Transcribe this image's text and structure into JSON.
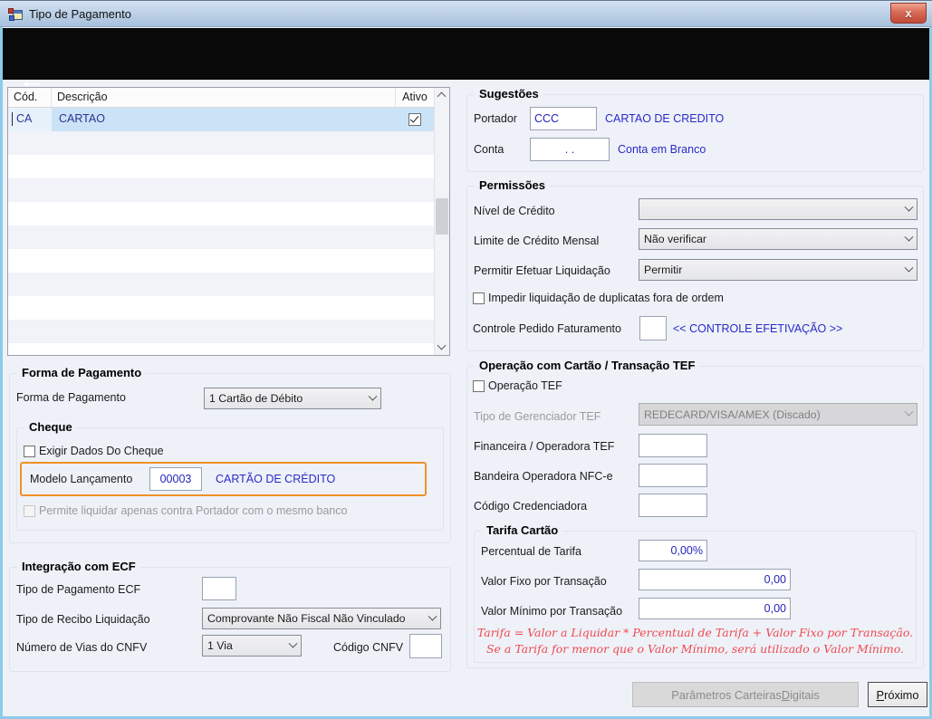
{
  "window": {
    "title": "Tipo de Pagamento"
  },
  "icons": {
    "close": "x",
    "back_arrow": "←",
    "app_icon": "winforms-window-icon",
    "chevron_down": "v-chevron",
    "check": "checkmark"
  },
  "grid": {
    "columns": {
      "cod": "Cód.",
      "descricao": "Descrição",
      "ativo": "Ativo"
    },
    "rows": [
      {
        "cod": "CA",
        "descricao": "CARTAO",
        "ativo_checked": true
      }
    ]
  },
  "forma_pagamento": {
    "title": "Forma de Pagamento",
    "label": "Forma de Pagamento",
    "value": "1 Cartão de Débito",
    "cheque": {
      "title": "Cheque",
      "exigir_checkbox": "Exigir Dados Do Cheque",
      "modelo_label": "Modelo Lançamento",
      "modelo_value": "00003",
      "modelo_desc": "CARTÃO DE CRÉDITO",
      "permite_checkbox": "Permite liquidar apenas contra Portador com o mesmo banco"
    }
  },
  "integracao_ecf": {
    "title": "Integração com ECF",
    "tipo_pagamento_label": "Tipo de Pagamento ECF",
    "tipo_pagamento_value": "",
    "tipo_recibo_label": "Tipo de Recibo Liquidação",
    "tipo_recibo_value": "Comprovante Não Fiscal Não Vinculado",
    "numero_vias_label": "Número de Vias do CNFV",
    "numero_vias_value": "1 Via",
    "codigo_cnfv_label": "Código CNFV",
    "codigo_cnfv_value": ""
  },
  "sugestoes": {
    "title": "Sugestões",
    "portador_label": "Portador",
    "portador_value": "CCC",
    "portador_desc": "CARTAO DE CREDITO",
    "conta_label": "Conta",
    "conta_value": ". .",
    "conta_desc": "Conta em Branco"
  },
  "permissoes": {
    "title": "Permissões",
    "nivel_label": "Nível de Crédito",
    "nivel_value": "",
    "limite_label": "Limite de Crédito Mensal",
    "limite_value": "Não verificar",
    "permitir_label": "Permitir Efetuar Liquidação",
    "permitir_value": "Permitir",
    "impedir_checkbox": "Impedir liquidação de duplicatas fora de ordem",
    "controle_label": "Controle Pedido Faturamento",
    "controle_value": "",
    "controle_link": "<< CONTROLE EFETIVAÇÃO >>"
  },
  "operacao_tef": {
    "title": "Operação com Cartão / Transação TEF",
    "operacao_checkbox": "Operação TEF",
    "gerenciador_label": "Tipo de Gerenciador TEF",
    "gerenciador_value": "REDECARD/VISA/AMEX (Discado)",
    "financeira_label": "Financeira / Operadora TEF",
    "financeira_value": "",
    "bandeira_label": "Bandeira Operadora NFC-e",
    "bandeira_value": "",
    "credenciadora_label": "Código Credenciadora",
    "credenciadora_value": "",
    "tarifa": {
      "title": "Tarifa Cartão",
      "percentual_label": "Percentual de Tarifa",
      "percentual_value": "0,00%",
      "fixo_label": "Valor Fixo por Transação",
      "fixo_value": "0,00",
      "minimo_label": "Valor Mínimo por Transação",
      "minimo_value": "0,00",
      "note_line1": "Tarifa = Valor a Liquidar *  Percentual de Tarifa + Valor Fixo por Transação.",
      "note_line2": "Se a Tarifa for menor que o Valor Mínimo, será utilizado o Valor Mínimo."
    }
  },
  "footer": {
    "parametros_parts": [
      "Parâmetros Carteiras ",
      "D",
      "igitais"
    ],
    "proximo_parts": [
      "P",
      "róximo"
    ]
  },
  "colors": {
    "accent_orange": "#ee9128",
    "link_blue": "#2a2ac8",
    "value_blue": "#2424bb",
    "note_red": "#ef4a50",
    "selected_row_blue": "#cbe3f7",
    "titlebar_blue": "#a7c0dd",
    "close_red": "#c14a38",
    "navbar_black": "#090909",
    "window_border_cyan": "#8ccbe9"
  }
}
